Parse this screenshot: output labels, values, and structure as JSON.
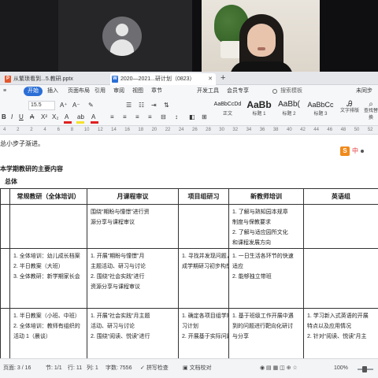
{
  "video_call": {
    "tiles": [
      {
        "id": "blank-left"
      },
      {
        "id": "avatar-placeholder"
      },
      {
        "id": "speaker-camera"
      },
      {
        "id": "blank-right"
      }
    ]
  },
  "tabs": [
    {
      "label": "从繁琐看到...5.教研.pptx",
      "icon": "ppt-icon",
      "icon_glyph": "P"
    },
    {
      "label": "2020—2021...研计划（0823）",
      "icon": "doc-icon",
      "icon_glyph": "W"
    }
  ],
  "tab_add_label": "+",
  "menu": {
    "items": [
      "开始",
      "插入",
      "页面布局",
      "引用",
      "审阅",
      "视图",
      "章节",
      "开发工具",
      "会员专享"
    ],
    "active_index": 0,
    "search_placeholder": "搜索模板",
    "right_label": "未同步"
  },
  "ribbon": {
    "font_size": "15.5",
    "style_cards": [
      {
        "sample": "AaBbCcDd",
        "label": "正文"
      },
      {
        "sample": "AaBb",
        "label": "标题 1"
      },
      {
        "sample": "AaBb(",
        "label": "标题 2"
      },
      {
        "sample": "AaBbCc",
        "label": "标题 3"
      }
    ],
    "text_tools_label": "文字排版",
    "find_label": "查找替换"
  },
  "ruler": {
    "numbers": [
      "4",
      "2",
      "2",
      "4",
      "6",
      "8",
      "10",
      "12",
      "14",
      "16",
      "18",
      "20",
      "22",
      "24",
      "26",
      "28",
      "30",
      "32",
      "34",
      "36",
      "38",
      "40",
      "42",
      "44",
      "46",
      "48",
      "50",
      "52"
    ]
  },
  "document": {
    "intro_line": "总小步子渐进。",
    "section_heading": "本学期教研的主要内容",
    "subheading": "总体",
    "ime_badge": {
      "logo": "S",
      "mode": "中"
    },
    "table": {
      "headers": [
        "常规教研（全体培训）",
        "月课程审议",
        "项目组研习",
        "新教师培训",
        "英语组"
      ],
      "rows": [
        [
          [],
          [
            "围绕“期盼与憧憬”进行资",
            "源分享与课程审议"
          ],
          [],
          [
            "1. 了解与熟知园本规章",
            "制度与保教要求",
            "2. 了解与适应园所文化",
            "和课程发展方向"
          ],
          []
        ],
        [
          [
            "1. 全体培训：幼儿成长档案",
            "2. 半日教案（大班）",
            "3. 全体教研：新学期家长会"
          ],
          [
            "1. 开展“期盼与憧憬”月",
            "主题活动、研习与讨论",
            "2. 围绕“社会实践”进行",
            "资源分享与课程审议"
          ],
          [
            "1. 寻找并发现问题，形",
            "成学期研习初步构想"
          ],
          [
            "1. 一日生活各环节的快速",
            "适应",
            "2. 能够独立带班"
          ],
          []
        ],
        [
          [
            "1. 半日教案（小班、中班）",
            "2. 全体培训：教师有组织的",
            "活动 1（晨谈）"
          ],
          [
            "1. 开展“社会实践”月主题",
            "活动、研习与讨论",
            "2. 围绕“阅读、悦读”进行"
          ],
          [
            "1. 确定各项目组学期研",
            "习计划",
            "2. 开展基于实际问题及"
          ],
          [
            "1. 基于班级工作开展中遇",
            "到的问题进行靶向化研讨",
            "与分享"
          ],
          [
            "1. 学习新入式英语的开展",
            "特点以及应用情况",
            "2. 针对“阅读、悦读”月主"
          ]
        ]
      ]
    }
  },
  "status_bar": {
    "page": "页面: 3 / 16",
    "section": "节: 1/1",
    "line": "行: 11",
    "column": "列: 1",
    "word_count": "字数: 7556",
    "spellcheck": "拼写检查",
    "proofread": "文档校对",
    "zoom": "100%"
  }
}
